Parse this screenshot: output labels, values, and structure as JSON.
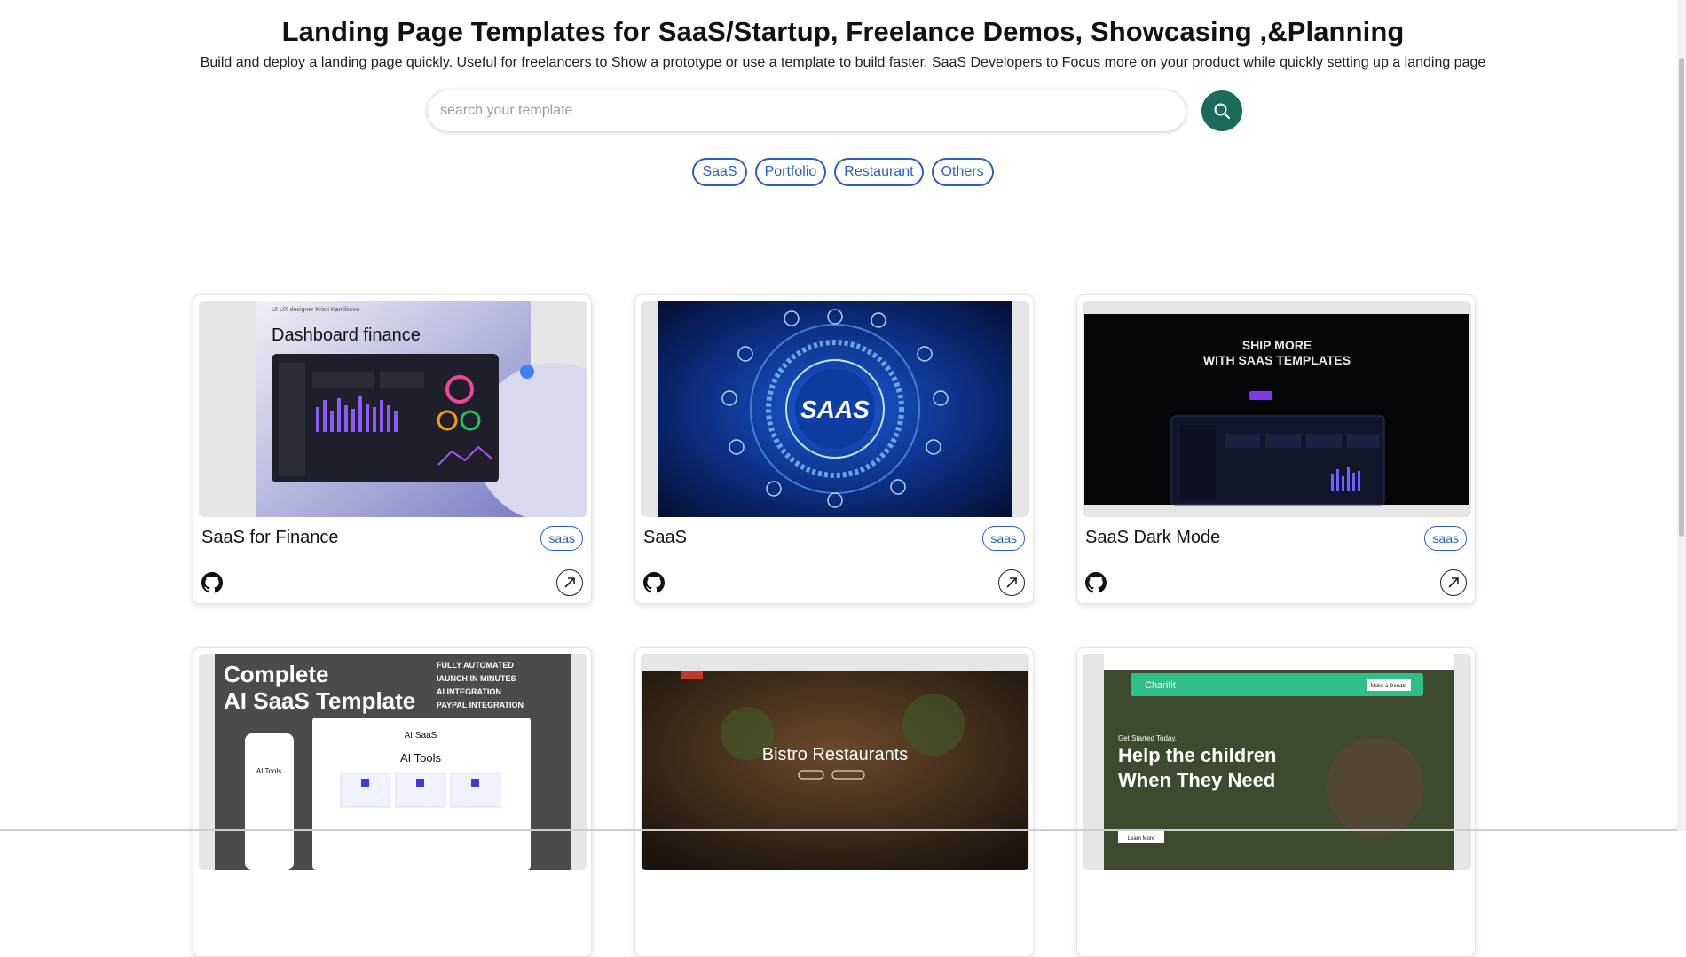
{
  "header": {
    "title": "Landing Page Templates for SaaS/Startup, Freelance Demos, Showcasing ,&Planning",
    "subtitle": "Build and deploy a landing page quickly. Useful for freelancers to Show a prototype or use a template to build faster. SaaS Developers to Focus more on your product while quickly setting up a landing page"
  },
  "search": {
    "placeholder": "search your template",
    "value": ""
  },
  "tags": [
    "SaaS",
    "Portfolio",
    "Restaurant",
    "Others"
  ],
  "cards": [
    {
      "title": "SaaS for Finance",
      "badge": "saas",
      "thumb_text": "Dashboard finance",
      "thumb_sub": "UI UX designer   Kristi Kamlikova"
    },
    {
      "title": "SaaS",
      "badge": "saas",
      "thumb_text": "SAAS"
    },
    {
      "title": "SaaS Dark Mode",
      "badge": "saas",
      "thumb_text": "SHIP MORE",
      "thumb_text2": "WITH SAAS TEMPLATES"
    },
    {
      "title": "",
      "badge": "",
      "thumb_text": "Complete",
      "thumb_text2": "AI SaaS Template",
      "thumb_list": [
        "FULLY AUTOMATED",
        "lAUNCH IN MINUTES",
        "AI INTEGRATION",
        "PAYPAL INTEGRATION"
      ],
      "thumb_inner_title": "AI Tools",
      "thumb_brand": "AI SaaS"
    },
    {
      "title": "",
      "badge": "",
      "thumb_text": "Bistro Restaurants"
    },
    {
      "title": "",
      "badge": "",
      "thumb_brand": "Charifit",
      "thumb_tag": "Get Started Today.",
      "thumb_text": "Help the children",
      "thumb_text2": "When They Need",
      "thumb_btn": "Learn More",
      "thumb_cta": "Make a Donate"
    }
  ],
  "colors": {
    "accent": "#2a5fc1",
    "search_button": "#1a6b5a"
  },
  "icons": {
    "search": "search-icon",
    "github": "github-icon",
    "open": "arrow-up-right-icon"
  }
}
